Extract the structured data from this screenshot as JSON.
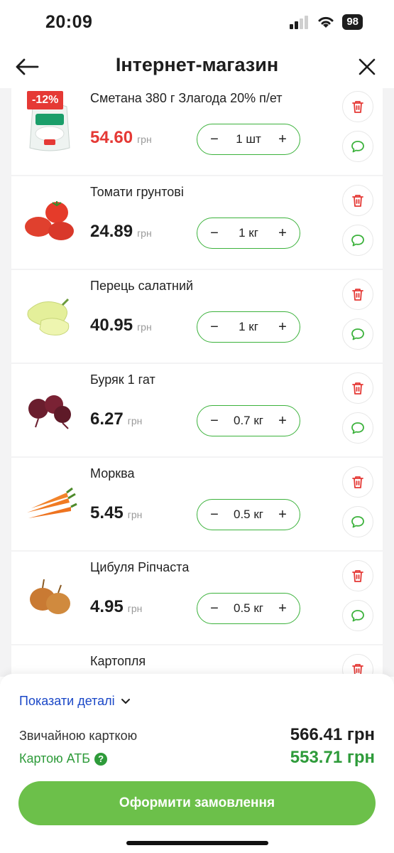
{
  "status": {
    "time": "20:09",
    "battery": "98"
  },
  "header": {
    "title": "Інтернет-магазин"
  },
  "currency_label": "грн",
  "items": [
    {
      "name": "Сметана 380 г Злагода 20% п/ет",
      "price": "54.60",
      "qty": "1 шт",
      "sale": true,
      "badge": "-12%"
    },
    {
      "name": "Томати грунтові",
      "price": "24.89",
      "qty": "1 кг",
      "sale": false
    },
    {
      "name": "Перець салатний",
      "price": "40.95",
      "qty": "1 кг",
      "sale": false
    },
    {
      "name": "Буряк 1 гат",
      "price": "6.27",
      "qty": "0.7 кг",
      "sale": false
    },
    {
      "name": "Морква",
      "price": "5.45",
      "qty": "0.5 кг",
      "sale": false
    },
    {
      "name": "Цибуля Ріпчаста",
      "price": "4.95",
      "qty": "0.5 кг",
      "sale": false
    },
    {
      "name": "Картопля"
    }
  ],
  "summary": {
    "details_link": "Показати деталі",
    "regular_label": "Звичайною карткою",
    "regular_total": "566.41 грн",
    "atb_label": "Картою АТБ",
    "atb_total": "553.71 грн",
    "help_symbol": "?",
    "checkout_label": "Оформити замовлення"
  },
  "colors": {
    "accent_green": "#6cc04a",
    "sale_red": "#e53935",
    "link_blue": "#1a47c7"
  }
}
